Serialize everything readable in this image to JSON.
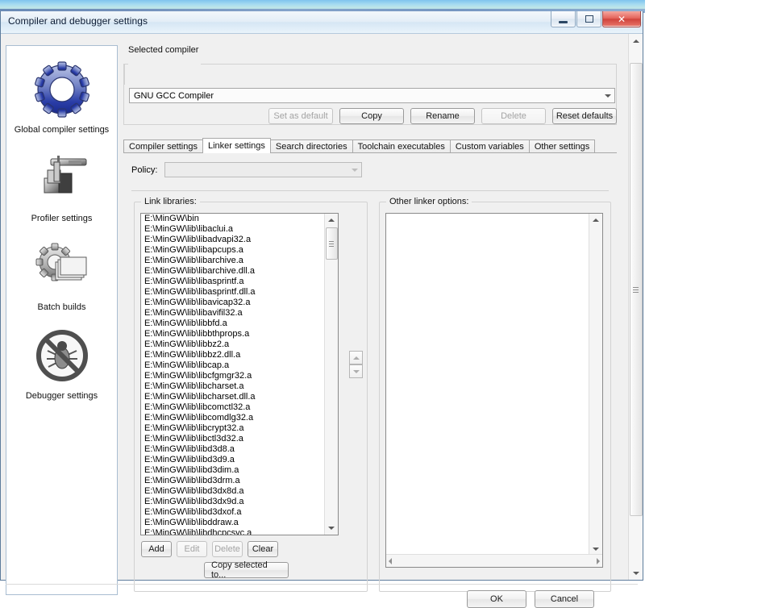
{
  "window": {
    "title": "Compiler and debugger settings",
    "controls": {
      "minimize": "minimize-button",
      "maximize": "maximize-button",
      "close": "✕"
    }
  },
  "sidebar": {
    "items": [
      {
        "label": "Global compiler settings",
        "icon": "gear-icon"
      },
      {
        "label": "Profiler settings",
        "icon": "caliper-icon"
      },
      {
        "label": "Batch builds",
        "icon": "gear-stack-icon"
      },
      {
        "label": "Debugger settings",
        "icon": "no-bug-icon"
      }
    ]
  },
  "selected_compiler": {
    "group_label": "Selected compiler",
    "value": "GNU GCC Compiler",
    "buttons": [
      {
        "label": "Set as default",
        "disabled": true
      },
      {
        "label": "Copy",
        "disabled": false
      },
      {
        "label": "Rename",
        "disabled": false
      },
      {
        "label": "Delete",
        "disabled": true
      },
      {
        "label": "Reset defaults",
        "disabled": false
      }
    ]
  },
  "tabs": [
    {
      "label": "Compiler settings",
      "active": false
    },
    {
      "label": "Linker settings",
      "active": true
    },
    {
      "label": "Search directories",
      "active": false
    },
    {
      "label": "Toolchain executables",
      "active": false
    },
    {
      "label": "Custom variables",
      "active": false
    },
    {
      "label": "Other settings",
      "active": false
    }
  ],
  "policy": {
    "label": "Policy:",
    "value": "",
    "disabled": true
  },
  "link_libraries": {
    "group_label": "Link libraries:",
    "items": [
      "E:\\MinGW\\bin",
      "E:\\MinGW\\lib\\libaclui.a",
      "E:\\MinGW\\lib\\libadvapi32.a",
      "E:\\MinGW\\lib\\libapcups.a",
      "E:\\MinGW\\lib\\libarchive.a",
      "E:\\MinGW\\lib\\libarchive.dll.a",
      "E:\\MinGW\\lib\\libasprintf.a",
      "E:\\MinGW\\lib\\libasprintf.dll.a",
      "E:\\MinGW\\lib\\libavicap32.a",
      "E:\\MinGW\\lib\\libavifil32.a",
      "E:\\MinGW\\lib\\libbfd.a",
      "E:\\MinGW\\lib\\libbthprops.a",
      "E:\\MinGW\\lib\\libbz2.a",
      "E:\\MinGW\\lib\\libbz2.dll.a",
      "E:\\MinGW\\lib\\libcap.a",
      "E:\\MinGW\\lib\\libcfgmgr32.a",
      "E:\\MinGW\\lib\\libcharset.a",
      "E:\\MinGW\\lib\\libcharset.dll.a",
      "E:\\MinGW\\lib\\libcomctl32.a",
      "E:\\MinGW\\lib\\libcomdlg32.a",
      "E:\\MinGW\\lib\\libcrypt32.a",
      "E:\\MinGW\\lib\\libctl3d32.a",
      "E:\\MinGW\\lib\\libd3d8.a",
      "E:\\MinGW\\lib\\libd3d9.a",
      "E:\\MinGW\\lib\\libd3dim.a",
      "E:\\MinGW\\lib\\libd3drm.a",
      "E:\\MinGW\\lib\\libd3dx8d.a",
      "E:\\MinGW\\lib\\libd3dx9d.a",
      "E:\\MinGW\\lib\\libd3dxof.a",
      "E:\\MinGW\\lib\\libddraw.a",
      "E:\\MinGW\\lib\\libdhcpcsvc.a"
    ],
    "buttons": [
      {
        "label": "Add",
        "disabled": false
      },
      {
        "label": "Edit",
        "disabled": true
      },
      {
        "label": "Delete",
        "disabled": true
      },
      {
        "label": "Clear",
        "disabled": false
      }
    ],
    "copy_selected_label": "Copy selected to..."
  },
  "other_linker_options": {
    "group_label": "Other linker options:",
    "value": ""
  },
  "dialog_buttons": [
    {
      "label": "OK"
    },
    {
      "label": "Cancel"
    }
  ]
}
